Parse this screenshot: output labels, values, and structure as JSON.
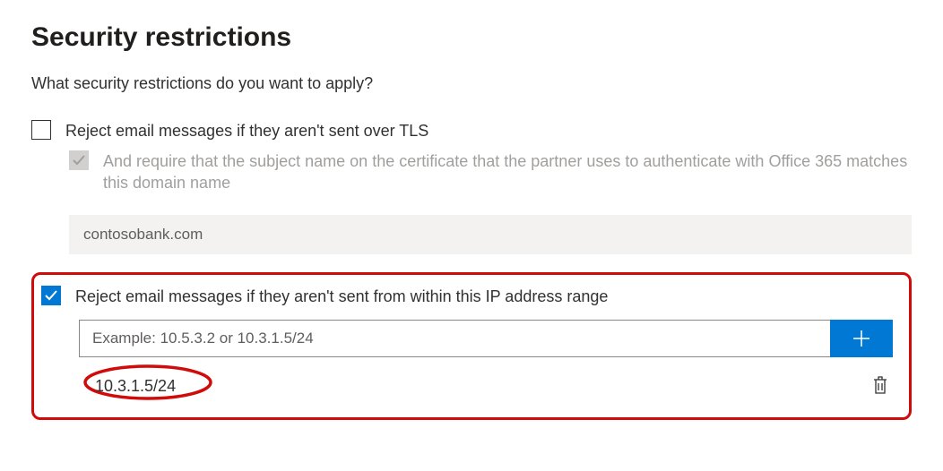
{
  "title": "Security restrictions",
  "subtitle": "What security restrictions do you want to apply?",
  "tls_option": {
    "checked": false,
    "label": "Reject email messages if they aren't sent over TLS"
  },
  "subject_option": {
    "label": "And require that the subject name on the certificate that the partner uses to authenticate with Office 365 matches this domain name",
    "domain_value": "contosobank.com"
  },
  "ip_option": {
    "checked": true,
    "label": "Reject email messages if they aren't sent from within this IP address range",
    "placeholder": "Example: 10.5.3.2 or 10.3.1.5/24",
    "entries": [
      "10.3.1.5/24"
    ]
  }
}
